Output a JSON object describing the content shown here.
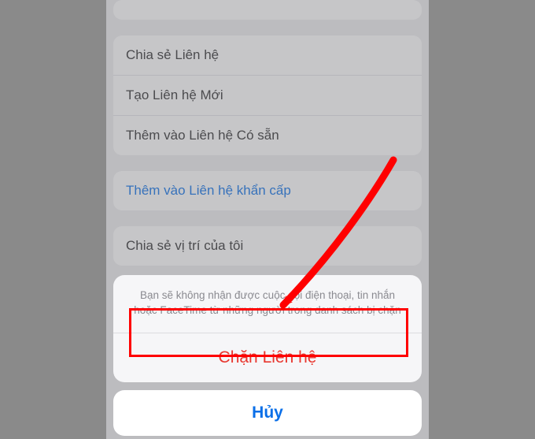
{
  "bg": {
    "row_share": "Chia sẻ Liên hệ",
    "row_create": "Tạo Liên hệ Mới",
    "row_add_existing": "Thêm vào Liên hệ Có sẵn",
    "row_emergency": "Thêm vào Liên hệ khẩn cấp",
    "row_share_location": "Chia sẻ vị trí của tôi"
  },
  "sheet": {
    "message": "Bạn sẽ không nhận được cuộc gọi điện thoại, tin nhắn hoặc FaceTime từ những người trong danh sách bị chặn",
    "block": "Chặn Liên hệ",
    "cancel": "Hủy"
  }
}
